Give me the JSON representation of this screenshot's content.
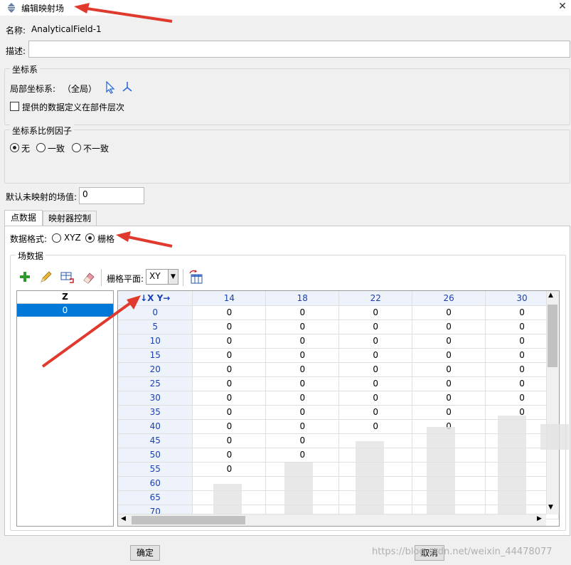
{
  "window": {
    "title": "编辑映射场",
    "close_label": "✕"
  },
  "name": {
    "label": "名称:",
    "value": "AnalyticalField-1"
  },
  "description": {
    "label": "描述:",
    "value": ""
  },
  "coord_group": {
    "title": "坐标系",
    "local_label": "局部坐标系:",
    "local_value": "（全局）",
    "checkbox_label": "提供的数据定义在部件层次",
    "checkbox_checked": false
  },
  "scale_group": {
    "title": "坐标系比例因子",
    "options": [
      {
        "label": "无",
        "checked": true
      },
      {
        "label": "一致",
        "checked": false
      },
      {
        "label": "不一致",
        "checked": false
      }
    ]
  },
  "default_value": {
    "label": "默认未映射的场值:",
    "value": "0"
  },
  "tabs": [
    {
      "label": "点数据",
      "active": true
    },
    {
      "label": "映射器控制",
      "active": false
    }
  ],
  "data_format": {
    "label": "数据格式:",
    "options": [
      {
        "label": "XYZ",
        "checked": false
      },
      {
        "label": "栅格",
        "checked": true
      }
    ]
  },
  "field_data": {
    "title": "场数据",
    "grid_plane_label": "栅格平面:",
    "grid_plane_value": "XY",
    "z_header": "Z",
    "z_values": [
      "0"
    ],
    "corner_label": "↓X Y→",
    "columns": [
      "14",
      "18",
      "22",
      "26",
      "30"
    ],
    "rows": [
      {
        "x": "0",
        "cells": [
          "0",
          "0",
          "0",
          "0",
          "0"
        ]
      },
      {
        "x": "5",
        "cells": [
          "0",
          "0",
          "0",
          "0",
          "0"
        ]
      },
      {
        "x": "10",
        "cells": [
          "0",
          "0",
          "0",
          "0",
          "0"
        ]
      },
      {
        "x": "15",
        "cells": [
          "0",
          "0",
          "0",
          "0",
          "0"
        ]
      },
      {
        "x": "20",
        "cells": [
          "0",
          "0",
          "0",
          "0",
          "0"
        ]
      },
      {
        "x": "25",
        "cells": [
          "0",
          "0",
          "0",
          "0",
          "0"
        ]
      },
      {
        "x": "30",
        "cells": [
          "0",
          "0",
          "0",
          "0",
          "0"
        ]
      },
      {
        "x": "35",
        "cells": [
          "0",
          "0",
          "0",
          "0",
          "0"
        ]
      },
      {
        "x": "40",
        "cells": [
          "0",
          "0",
          "0",
          "0",
          ""
        ]
      },
      {
        "x": "45",
        "cells": [
          "0",
          "0",
          "",
          "",
          ""
        ]
      },
      {
        "x": "50",
        "cells": [
          "0",
          "0",
          "",
          "",
          ""
        ]
      },
      {
        "x": "55",
        "cells": [
          "0",
          "",
          "",
          "",
          ""
        ]
      },
      {
        "x": "60",
        "cells": [
          "",
          "",
          "",
          "",
          ""
        ]
      },
      {
        "x": "65",
        "cells": [
          "",
          "",
          "",
          "",
          ""
        ]
      },
      {
        "x": "70",
        "cells": [
          "",
          "",
          "",
          "",
          ""
        ]
      }
    ]
  },
  "buttons": {
    "ok": "确定",
    "cancel": "取消"
  },
  "watermark": "https://blog.csdn.net/weixin_44478077",
  "colors": {
    "arrow": "#e03a2f",
    "selection": "#0078d7",
    "header_text": "#1a3fb0"
  }
}
